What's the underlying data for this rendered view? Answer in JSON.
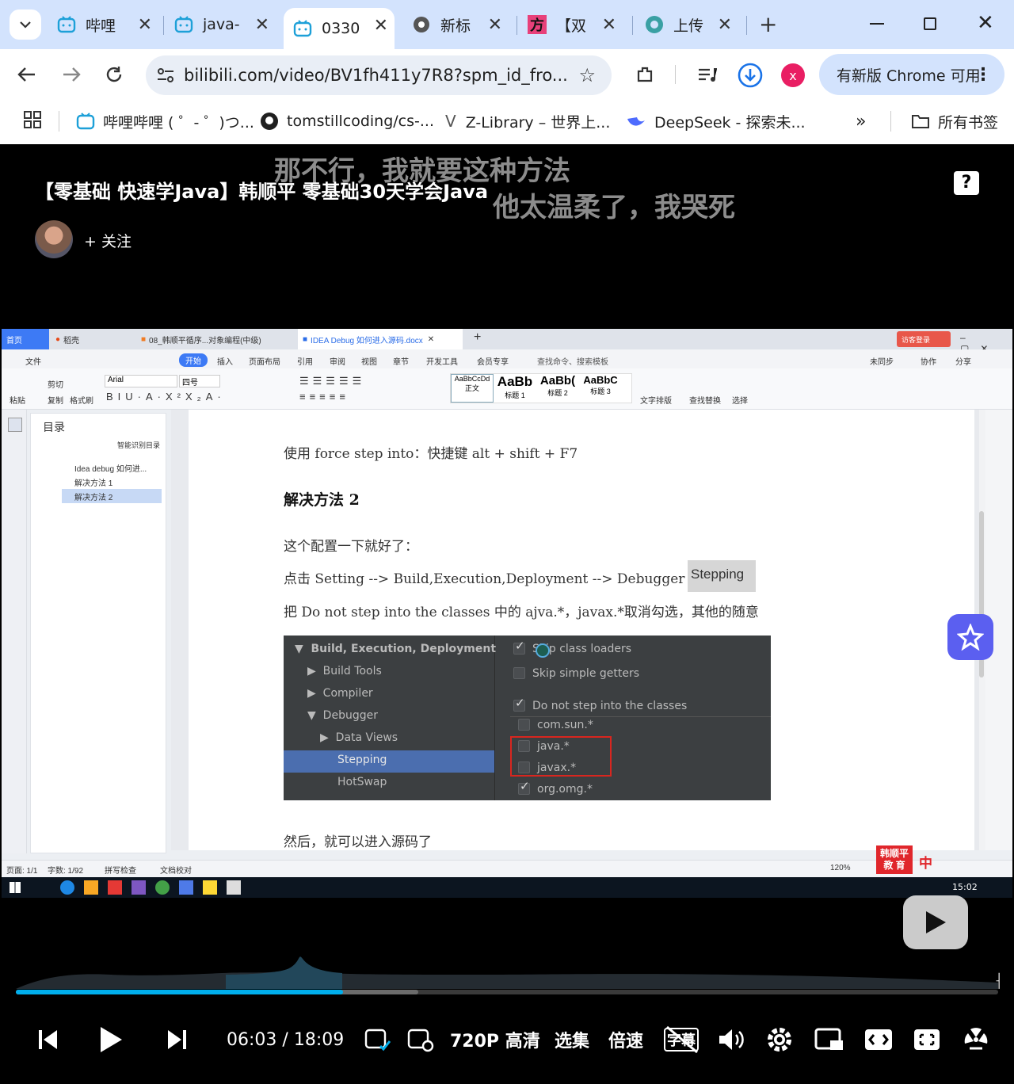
{
  "browser": {
    "tabs": [
      {
        "title": "哔哩",
        "icon": "bilibili-icon"
      },
      {
        "title": "java-",
        "icon": "bilibili-icon"
      },
      {
        "title": "0330",
        "icon": "bilibili-icon",
        "active": true
      },
      {
        "title": "新标",
        "icon": "chrome-icon"
      },
      {
        "title": "【双",
        "icon": "fang-icon"
      },
      {
        "title": "上传",
        "icon": "upload-icon"
      }
    ],
    "fang_glyph": "方",
    "url": "bilibili.com/video/BV1fh411y7R8?spm_id_fro...",
    "profile_letter": "x",
    "update_label": "有新版 Chrome 可用",
    "bookmarks": [
      {
        "label": "哔哩哔哩 ( ゜- ゜)つ...",
        "icon": "bilibili-icon"
      },
      {
        "label": "tomstillcoding/cs-...",
        "icon": "github-icon"
      },
      {
        "label": "Z-Library – 世界上...",
        "icon": "zlib-icon"
      },
      {
        "label": "DeepSeek - 探索未...",
        "icon": "deepseek-icon"
      }
    ],
    "more_bookmarks": "»",
    "all_bookmarks": "所有书签"
  },
  "video": {
    "title": "【零基础 快速学Java】韩顺平 零基础30天学会Java",
    "follow_label": "+ 关注",
    "danmaku": [
      "那不行，我就要这种方法",
      "他太温柔了，我哭死"
    ],
    "help": "?"
  },
  "word": {
    "tabs": [
      "首页",
      "稻壳",
      "08_韩顺平循序...对象编程(中级)",
      "IDEA Debug 如何进入源码.docx"
    ],
    "login": "访客登录",
    "menu": [
      "文件",
      "开始",
      "插入",
      "页面布局",
      "引用",
      "审阅",
      "视图",
      "章节",
      "开发工具",
      "会员专享"
    ],
    "search": "查找命令、搜索模板",
    "right_menu": [
      "未同步",
      "协作",
      "分享"
    ],
    "font": "Arial",
    "size": "四号",
    "ribbon_left": [
      "粘贴",
      "剪切",
      "复制",
      "格式刷"
    ],
    "styles": [
      {
        "sample": "AaBbCcDd",
        "name": "正文"
      },
      {
        "sample": "AaBb",
        "name": "标题 1"
      },
      {
        "sample": "AaBb(",
        "name": "标题 2"
      },
      {
        "sample": "AaBbC",
        "name": "标题 3"
      }
    ],
    "ribbon_right": [
      "文字排版",
      "查找替换",
      "选择"
    ],
    "toc_title": "目录",
    "toc_smart": "智能识别目录",
    "toc_items": [
      "Idea debug 如何进...",
      "解决方法 1",
      "解决方法 2"
    ],
    "doc": {
      "line1": "使用 force step into：快捷键  alt + shift + F7",
      "heading": "解决方法 2",
      "line2": "这个配置一下就好了：",
      "line3a": "点击 Setting --> Build,Execution,Deployment --> Debugger -->",
      "line3b": "Stepping",
      "line4": "把 Do not step into the classes 中的 ajva.*，javax.*取消勾选，其他的随意",
      "line5": "然后，就可以进入源码了"
    },
    "shot": {
      "tree": [
        "Build, Execution, Deployment",
        "Build Tools",
        "Compiler",
        "Debugger",
        "Data Views",
        "Stepping",
        "HotSwap"
      ],
      "checks": [
        {
          "label": "Skip class loaders",
          "checked": true
        },
        {
          "label": "Skip simple getters",
          "checked": false
        },
        {
          "label": "Do not step into the classes",
          "checked": true
        },
        {
          "label": "com.sun.*",
          "checked": false
        },
        {
          "label": "java.*",
          "checked": false
        },
        {
          "label": "javax.*",
          "checked": false
        },
        {
          "label": "org.omg.*",
          "checked": true
        }
      ]
    },
    "status": {
      "page": "页面: 1/1",
      "words": "字数: 1/92",
      "spell": "拼写检查",
      "proof": "文档校对",
      "zoom": "120%"
    },
    "brand": "韩顺平 教 育",
    "ime": "中",
    "clock": "15:02"
  },
  "player": {
    "progress": 0.333,
    "buffered": 0.41,
    "time_current": "06:03",
    "time_sep": "/",
    "time_total": "18:09",
    "quality": "720P 高清",
    "episodes": "选集",
    "speed": "倍速",
    "subtitle": "字幕"
  }
}
